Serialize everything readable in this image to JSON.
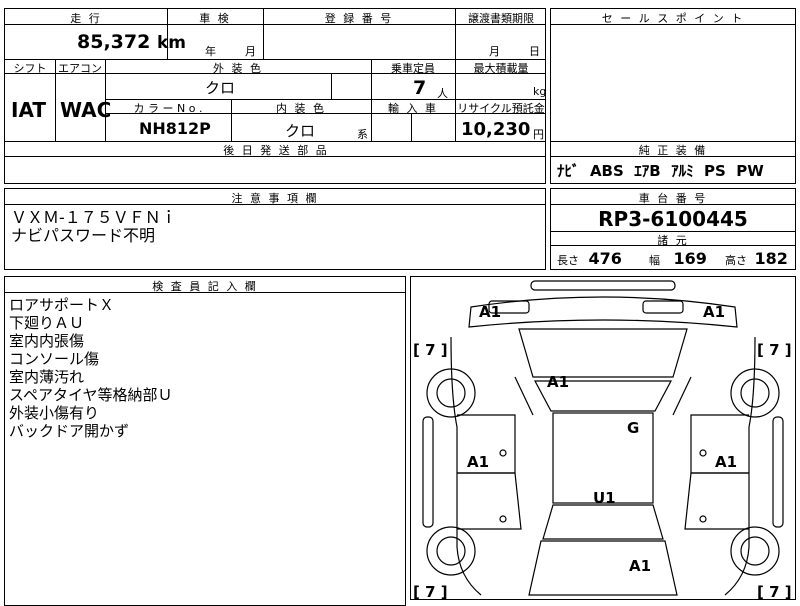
{
  "top_form": {
    "mileage_label": "走 行",
    "mileage_value": "85,372",
    "mileage_unit": "km",
    "inspection_label": "車 検",
    "year_label": "年",
    "month_label": "月",
    "registration_label": "登 録 番 号",
    "transfer_deadline_label": "譲渡書類期限",
    "transfer_month": "月",
    "transfer_day": "日",
    "shift_label": "シフト",
    "ac_label": "エアコン",
    "exterior_color_label": "外 装 色",
    "exterior_color_value": "クロ",
    "capacity_label": "乗車定員",
    "capacity_value": "7",
    "capacity_unit": "人",
    "max_load_label": "最大積載量",
    "max_load_unit": "kg",
    "shift_value": "IAT",
    "ac_value": "WAC",
    "color_no_label": "カ ラ ー N o .",
    "color_no_value": "NH812P",
    "interior_color_label": "内 装 色",
    "interior_color_value": "クロ",
    "interior_color_suffix": "系",
    "import_label": "輸 入 車",
    "recycle_label": "リサイクル預託金",
    "recycle_value": "10,230",
    "recycle_unit": "円",
    "later_parts_label": "後 日 発 送 部 品"
  },
  "sales_point": {
    "label": "セ ー ル ス ポ イ ン ト"
  },
  "standard_equipment": {
    "label": "純 正 装 備",
    "value": "ﾅﾋﾞ  ABS  ｴｱB  ｱﾙﾐ  PS  PW"
  },
  "notes": {
    "label": "注 意 事 項 欄",
    "lines": [
      "ＶＸＭ-１７５ＶＦＮｉ",
      "ナビパスワード不明"
    ]
  },
  "chassis": {
    "label": "車 台 番 号",
    "value": "RP3-6100445",
    "specs_label": "諸 元",
    "length_label": "長さ",
    "length_value": "476",
    "width_label": "幅",
    "width_value": "169",
    "height_label": "高さ",
    "height_value": "182"
  },
  "inspector": {
    "label": "検 査 員 記 入 欄",
    "lines": [
      "ロアサポートＸ",
      "下廻りＡＵ",
      "室内内張傷",
      "コンソール傷",
      "室内薄汚れ",
      "スペアタイヤ等格納部Ｕ",
      "外装小傷有り",
      "バックドア開かず"
    ]
  },
  "diagram": {
    "marks": {
      "front_left": "A1",
      "front_right": "A1",
      "hood": "A1",
      "roof": "G",
      "left_side": "A1",
      "right_side": "A1",
      "rear_center": "U1",
      "rear_bottom": "A1"
    },
    "tire_marks": [
      "[ 7 ]",
      "[ 7 ]",
      "[ 7 ]",
      "[ 7 ]"
    ]
  }
}
